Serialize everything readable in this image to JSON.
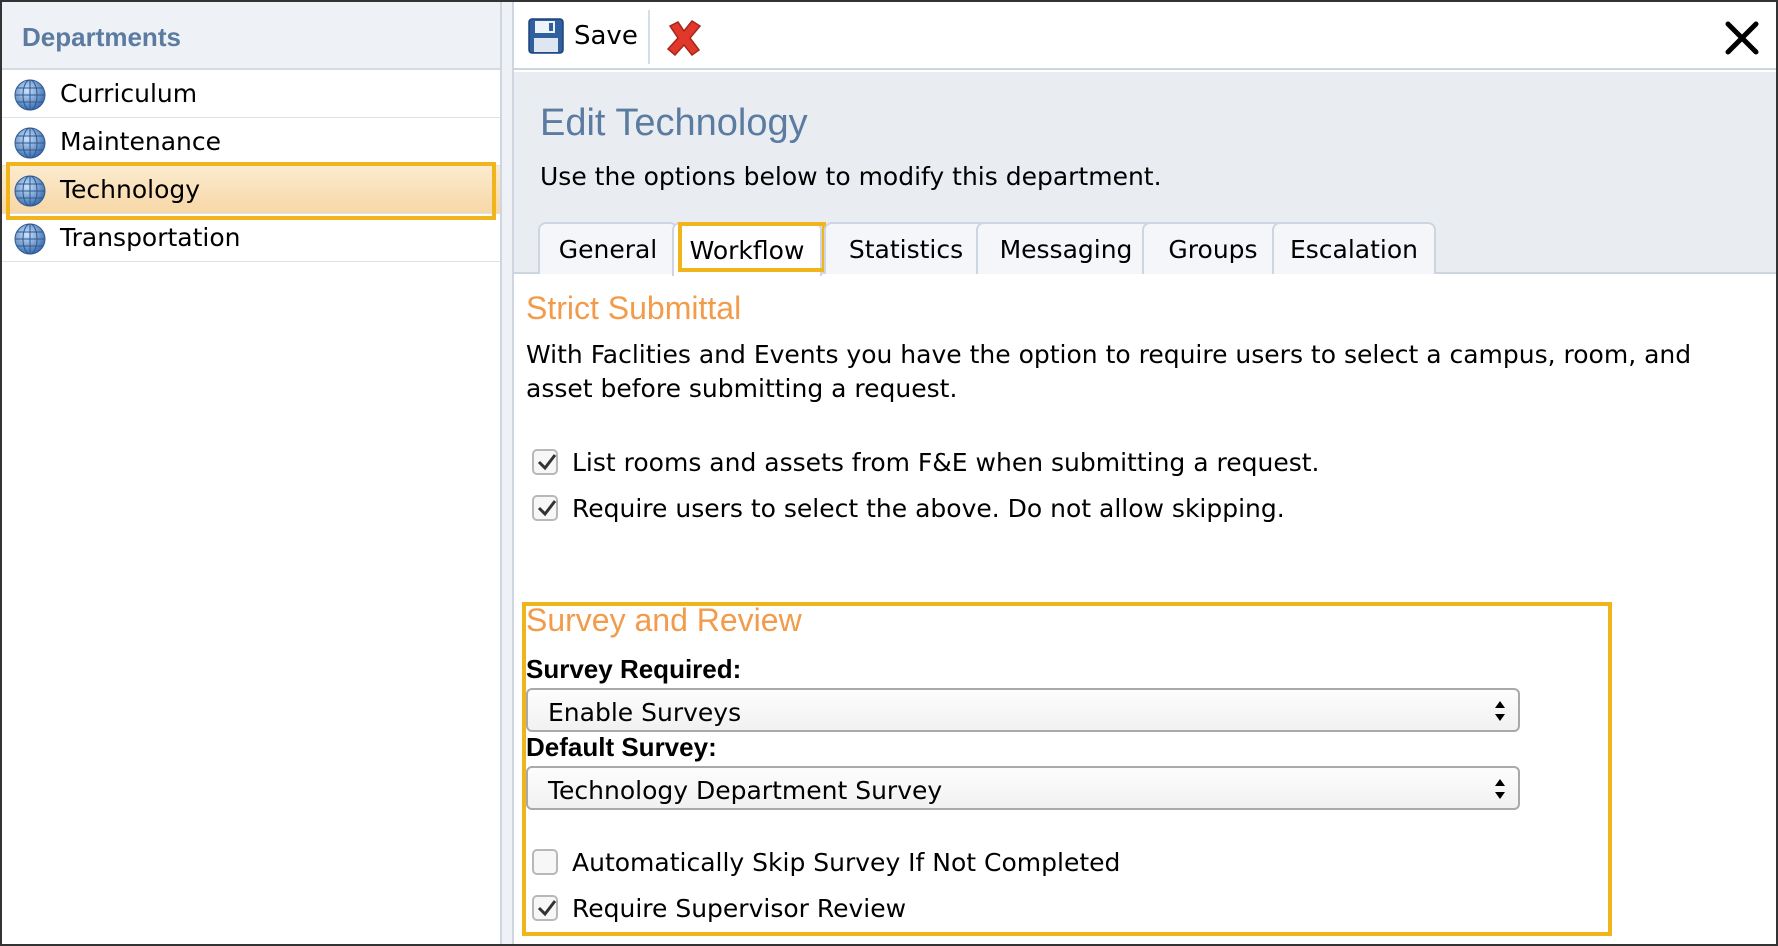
{
  "sidebar": {
    "title": "Departments",
    "items": [
      {
        "label": "Curriculum"
      },
      {
        "label": "Maintenance"
      },
      {
        "label": "Technology"
      },
      {
        "label": "Transportation"
      }
    ],
    "selected_index": 2
  },
  "toolbar": {
    "save_label": "Save",
    "icons": {
      "save": "floppy-disk-icon",
      "delete": "red-x-icon",
      "close": "close-icon"
    }
  },
  "header": {
    "title": "Edit Technology",
    "subtitle": "Use the options below to modify this department."
  },
  "tabs": [
    {
      "label": "General"
    },
    {
      "label": "Workflow",
      "active": true
    },
    {
      "label": "Statistics"
    },
    {
      "label": "Messaging"
    },
    {
      "label": "Groups"
    },
    {
      "label": "Escalation"
    }
  ],
  "strict_submittal": {
    "title": "Strict Submittal",
    "description": "With Faclities and Events you have the option to require users to select a campus, room, and asset before submitting a request.",
    "options": [
      {
        "label": "List rooms and assets from F&E when submitting a request.",
        "checked": true
      },
      {
        "label": "Require users to select the above. Do not allow skipping.",
        "checked": true
      }
    ]
  },
  "survey_review": {
    "title": "Survey and Review",
    "survey_required_label": "Survey Required:",
    "survey_required_value": "Enable Surveys",
    "default_survey_label": "Default Survey:",
    "default_survey_value": "Technology Department Survey",
    "options": [
      {
        "label": "Automatically Skip Survey If Not Completed",
        "checked": false
      },
      {
        "label": "Require Supervisor Review",
        "checked": true
      }
    ]
  },
  "colors": {
    "accent_title": "#5b7ba0",
    "section_title": "#f29b4b",
    "highlight": "#f0b41c"
  }
}
